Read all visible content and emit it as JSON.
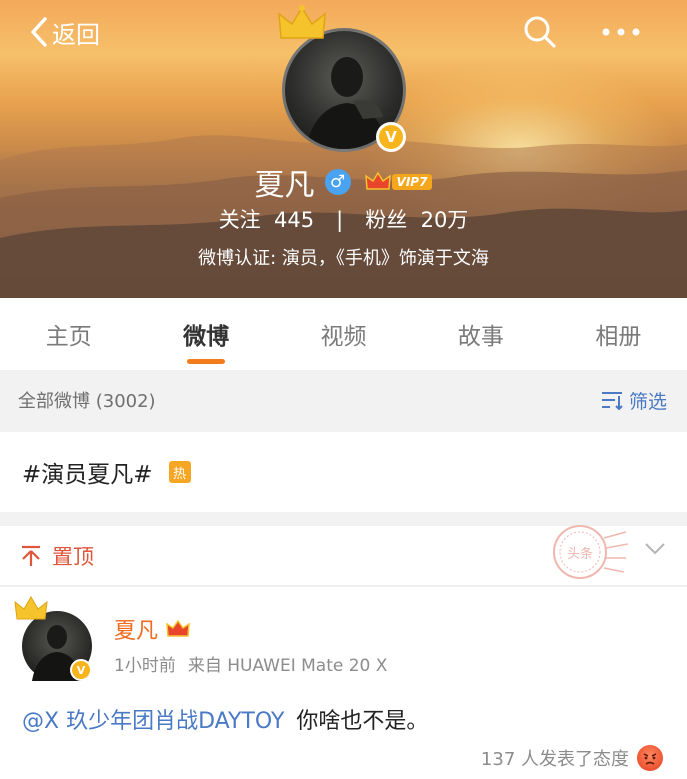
{
  "nav": {
    "back_label": "返回",
    "icons": [
      "chevron-left-icon",
      "search-icon",
      "more-icon"
    ]
  },
  "profile": {
    "name": "夏凡",
    "verified_badge": "V",
    "gender_symbol": "♂",
    "vip_label": "VIP7",
    "following_label": "关注",
    "following_count": "445",
    "separator": "|",
    "fans_label": "粉丝",
    "fans_count": "20万",
    "verification": "微博认证: 演员，《手机》饰演于文海"
  },
  "tabs": [
    {
      "label": "主页",
      "active": false
    },
    {
      "label": "微博",
      "active": true
    },
    {
      "label": "视频",
      "active": false
    },
    {
      "label": "故事",
      "active": false
    },
    {
      "label": "相册",
      "active": false
    }
  ],
  "filter_bar": {
    "all_label": "全部微博 (3002)",
    "filter_label": "筛选"
  },
  "topic": {
    "text": "#演员夏凡#",
    "hot_label": "热"
  },
  "pinned": {
    "label": "置顶",
    "stamp_text": "头条"
  },
  "post": {
    "author": "夏凡",
    "verified_badge": "V",
    "time": "1小时前",
    "source": "来自 HUAWEI Mate 20 X",
    "mention": "@X 玖少年团肖战DAYTOY",
    "body": "你啥也不是。",
    "reactions": "137 人发表了态度"
  },
  "colors": {
    "accent": "#f27c1b",
    "link": "#4a79c6",
    "pin": "#e0563b",
    "verified": "#f7b51b",
    "name": "#f06a1f"
  }
}
